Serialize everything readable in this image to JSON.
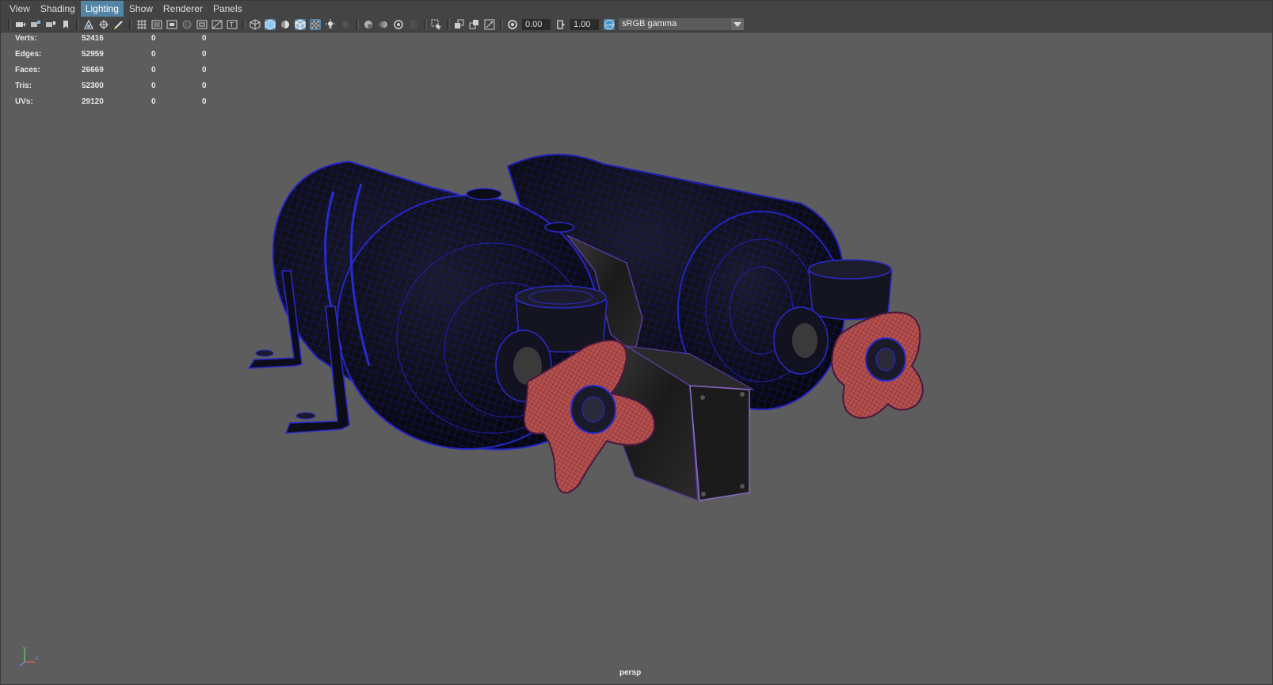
{
  "menu": {
    "items": [
      {
        "label": "View"
      },
      {
        "label": "Shading"
      },
      {
        "label": "Lighting"
      },
      {
        "label": "Show"
      },
      {
        "label": "Renderer"
      },
      {
        "label": "Panels"
      }
    ],
    "active_item": "Lighting"
  },
  "toolbar": {
    "exposure_value": "0.00",
    "gamma_value": "1.00",
    "color_space": "sRGB gamma",
    "icons": [
      "select-camera-icon",
      "camera-attributes-icon",
      "bookmarks-icon",
      "image-plane-icon",
      "two-d-pan-zoom-icon",
      "grease-pencil-icon",
      "grid-icon",
      "film-gate-icon",
      "resolution-gate-icon",
      "gate-mask-icon",
      "field-chart-icon",
      "safe-action-icon",
      "safe-title-icon",
      "wireframe-icon",
      "smooth-shade-icon",
      "use-default-material-icon",
      "wireframe-on-shaded-icon",
      "xray-icon",
      "use-all-lights-icon",
      "shadows-icon",
      "screen-space-ao-icon",
      "motion-blur-icon",
      "multisample-aa-icon",
      "depth-of-field-icon",
      "isolate-select-icon",
      "xray-joints-icon",
      "xray-active-components-icon",
      "exposure-icon",
      "gamma-icon",
      "color-management-icon"
    ]
  },
  "hud": {
    "rows": [
      {
        "label": "Verts:",
        "total": "52416",
        "selected": "0",
        "extra": "0"
      },
      {
        "label": "Edges:",
        "total": "52959",
        "selected": "0",
        "extra": "0"
      },
      {
        "label": "Faces:",
        "total": "26669",
        "selected": "0",
        "extra": "0"
      },
      {
        "label": "Tris:",
        "total": "52300",
        "selected": "0",
        "extra": "0"
      },
      {
        "label": "UVs:",
        "total": "29120",
        "selected": "0",
        "extra": "0"
      }
    ]
  },
  "viewport": {
    "camera_label": "persp",
    "axis_labels": {
      "x": "x",
      "y": "y",
      "z": "z"
    },
    "colors": {
      "background": "#5d5d5d",
      "wireframe": "#1a1aa8",
      "tank_fill": "#101018",
      "knob_fill": "#b5504a",
      "knob_wire": "#2a0a30",
      "bracket": "#1a1a1a"
    }
  }
}
